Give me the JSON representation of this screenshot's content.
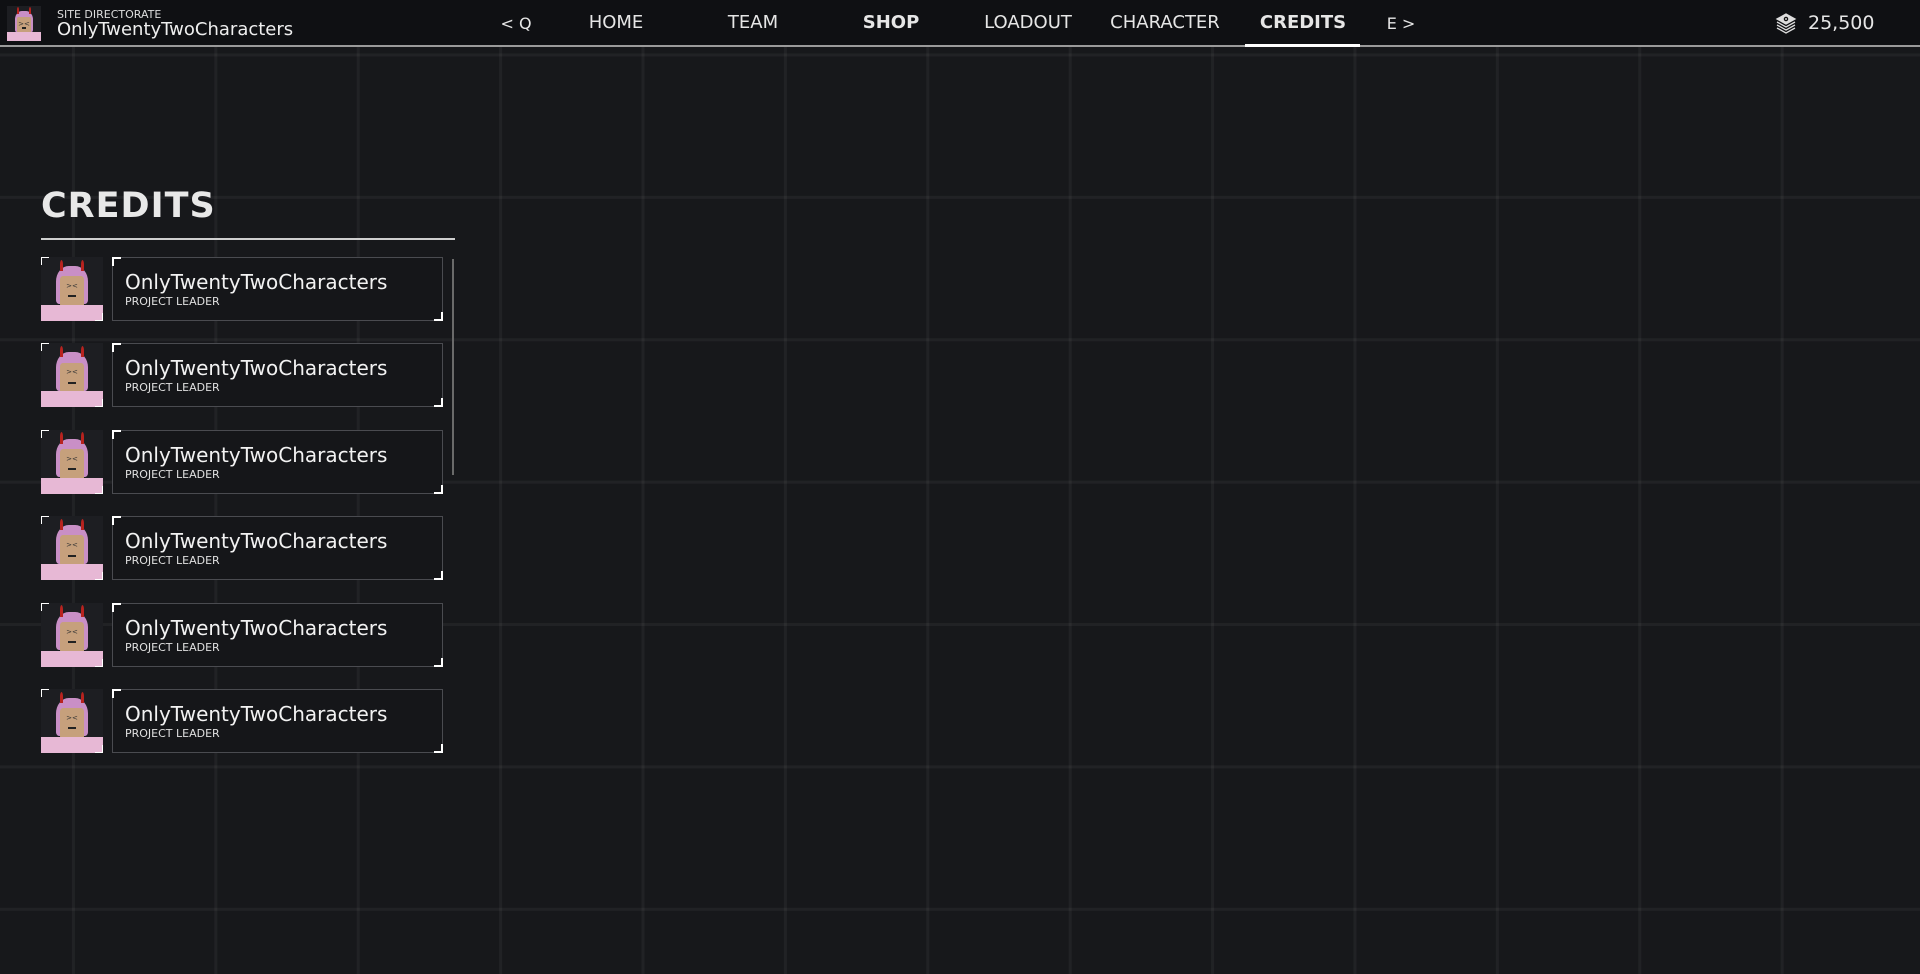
{
  "header": {
    "subtitle": "SITE DIRECTORATE",
    "username": "OnlyTwentyTwoCharacters",
    "currency": "25,500",
    "currency_icon": "cash-stack-icon"
  },
  "nav": {
    "prev": "< Q",
    "items": [
      "HOME",
      "TEAM",
      "SHOP",
      "LOADOUT",
      "CHARACTER",
      "CREDITS"
    ],
    "next": "E >",
    "active": "CREDITS"
  },
  "page": {
    "title": "CREDITS"
  },
  "credits": [
    {
      "name": "OnlyTwentyTwoCharacters",
      "role": "PROJECT LEADER"
    },
    {
      "name": "OnlyTwentyTwoCharacters",
      "role": "PROJECT LEADER"
    },
    {
      "name": "OnlyTwentyTwoCharacters",
      "role": "PROJECT LEADER"
    },
    {
      "name": "OnlyTwentyTwoCharacters",
      "role": "PROJECT LEADER"
    },
    {
      "name": "OnlyTwentyTwoCharacters",
      "role": "PROJECT LEADER"
    },
    {
      "name": "OnlyTwentyTwoCharacters",
      "role": "PROJECT LEADER"
    }
  ]
}
